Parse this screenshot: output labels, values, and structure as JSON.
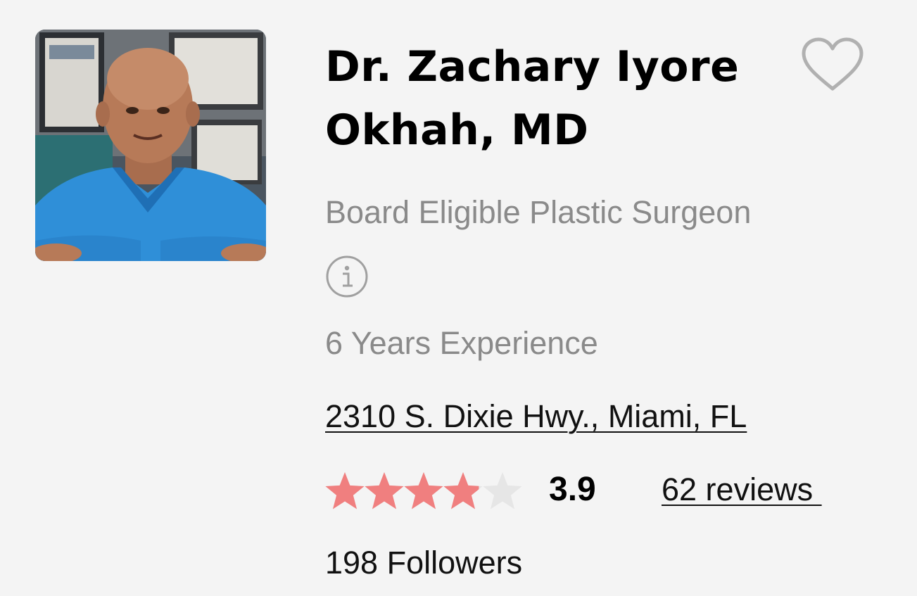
{
  "doctor": {
    "name": "Dr. Zachary Iyore Okhah, MD",
    "specialty": "Board Eligible Plastic Surgeon",
    "experience": "6 Years Experience",
    "address": "2310 S. Dixie Hwy., Miami, FL",
    "rating": "3.9",
    "rating_fraction": 0.78,
    "reviews_label": "62 reviews ",
    "followers_label": "198 Followers"
  },
  "colors": {
    "star_filled": "#f07f7f",
    "star_empty": "#e6e6e6",
    "muted_text": "#8a8a8a",
    "scrub_blue": "#2f8fd8"
  },
  "icons": {
    "favorite": "heart-outline-icon",
    "info": "info-circle-icon",
    "rating": "star-icon"
  }
}
